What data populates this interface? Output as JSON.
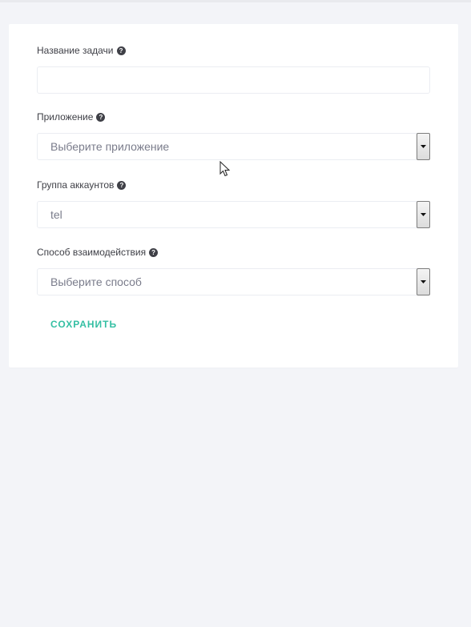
{
  "form": {
    "task_name": {
      "label": "Название задачи",
      "value": "",
      "placeholder": ""
    },
    "app": {
      "label": "Приложение",
      "selected": "Выберите приложение"
    },
    "account_group": {
      "label": "Группа аккаунтов",
      "selected": "tel"
    },
    "interaction_method": {
      "label": "Способ взаимодействия",
      "selected": "Выберите способ"
    },
    "save_label": "СОХРАНИТЬ"
  },
  "icons": {
    "help": "question-circle-icon",
    "dropdown": "chevron-down-icon",
    "cursor": "mouse-pointer-icon"
  },
  "colors": {
    "accent": "#34bfa3",
    "background": "#f3f4f8",
    "card": "#ffffff",
    "label_text": "#3f4047",
    "placeholder_text": "#7a7c8b"
  }
}
